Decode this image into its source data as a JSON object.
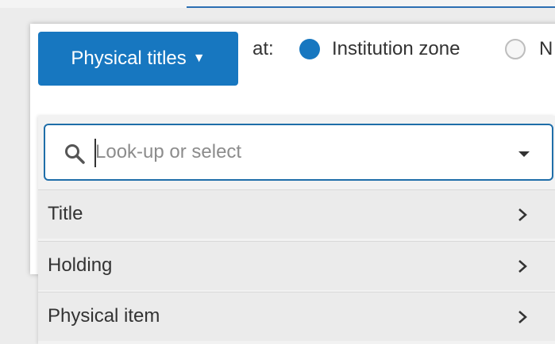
{
  "scope_button": {
    "label": "Physical titles",
    "caret": "▼"
  },
  "scope_selector": {
    "prefix": "at:",
    "options": [
      {
        "label": "Institution zone",
        "selected": true
      },
      {
        "label": "N",
        "selected": false
      }
    ]
  },
  "search": {
    "placeholder": "Look-up or select"
  },
  "menu": {
    "items": [
      {
        "label": "Title"
      },
      {
        "label": "Holding"
      },
      {
        "label": "Physical item"
      }
    ]
  },
  "colors": {
    "accent": "#1777c0",
    "border": "#1f6ea9"
  }
}
